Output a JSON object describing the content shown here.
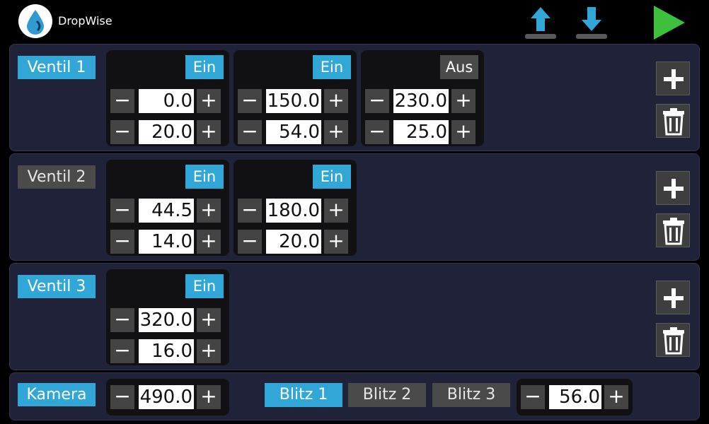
{
  "header": {
    "title": "DropWise",
    "logo_icon": "water-drop-icon",
    "upload_icon": "upload-arrow-icon",
    "download_icon": "download-arrow-icon",
    "play_icon": "play-icon"
  },
  "colors": {
    "accent": "#31a7d8",
    "panel": "#1f2238",
    "play": "#3ec03e"
  },
  "controls": {
    "minus": "−",
    "plus": "+"
  },
  "ventile": [
    {
      "label": "Ventil 1",
      "active": true,
      "pulses": [
        {
          "state": "Ein",
          "on": true,
          "start": "0.0",
          "duration": "20.0"
        },
        {
          "state": "Ein",
          "on": true,
          "start": "150.0",
          "duration": "54.0"
        },
        {
          "state": "Aus",
          "on": false,
          "start": "230.0",
          "duration": "25.0"
        }
      ]
    },
    {
      "label": "Ventil 2",
      "active": false,
      "pulses": [
        {
          "state": "Ein",
          "on": true,
          "start": "44.5",
          "duration": "14.0"
        },
        {
          "state": "Ein",
          "on": true,
          "start": "180.0",
          "duration": "20.0"
        }
      ]
    },
    {
      "label": "Ventil 3",
      "active": true,
      "pulses": [
        {
          "state": "Ein",
          "on": true,
          "start": "320.0",
          "duration": "16.0"
        }
      ]
    }
  ],
  "kamera": {
    "label": "Kamera",
    "value": "490.0",
    "blitz": [
      {
        "label": "Blitz 1",
        "active": true
      },
      {
        "label": "Blitz 2",
        "active": false
      },
      {
        "label": "Blitz 3",
        "active": false
      }
    ],
    "blitz_value": "56.0"
  }
}
